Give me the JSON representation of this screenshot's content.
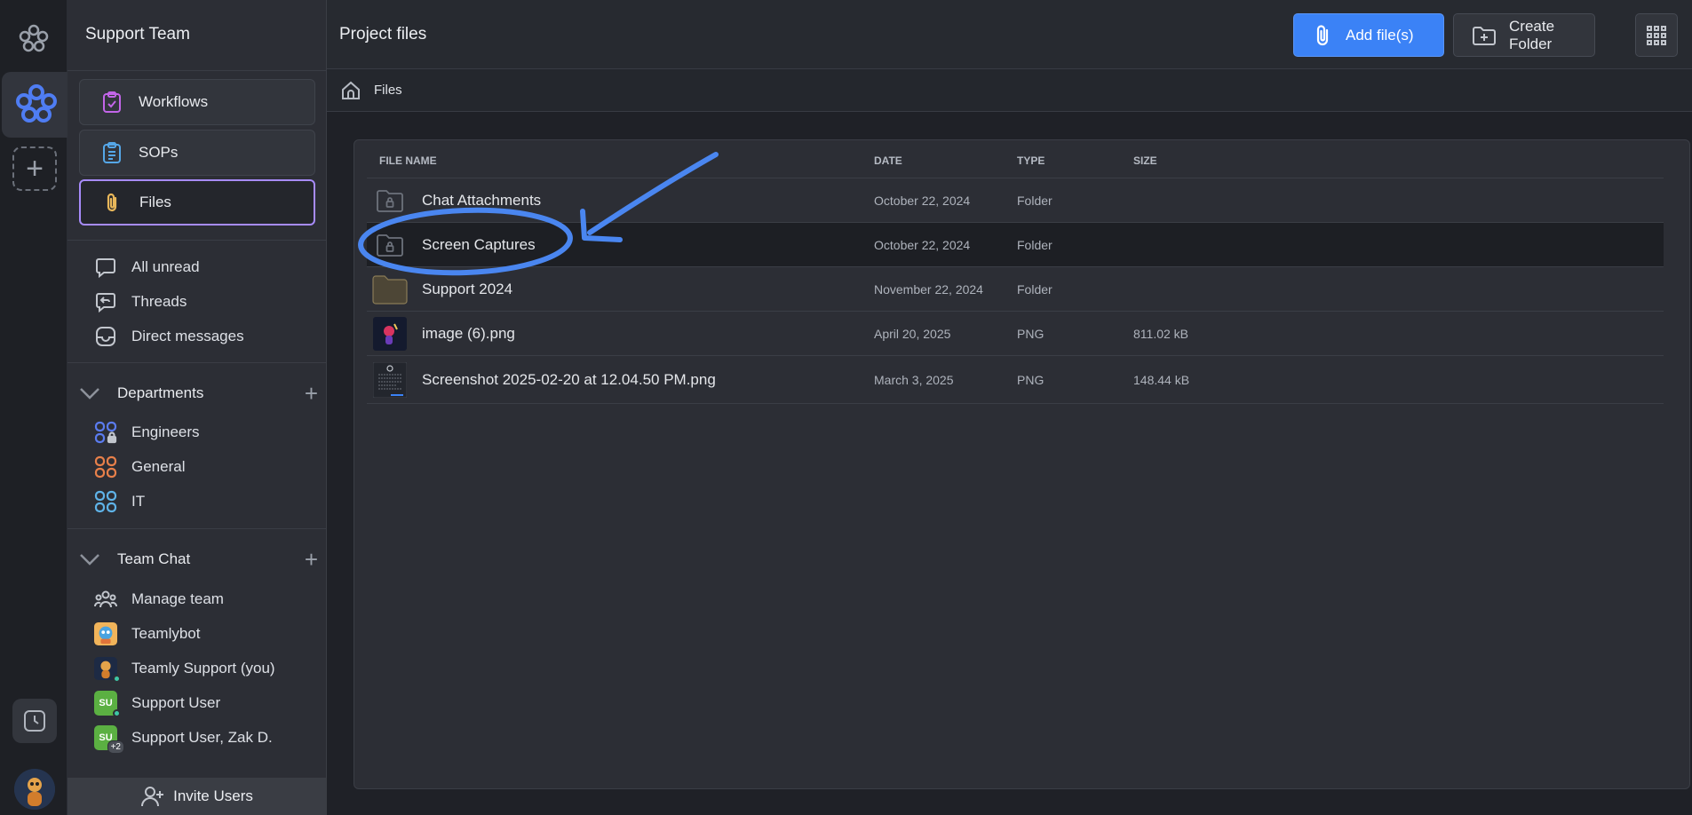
{
  "sidebar": {
    "workspace_title": "Support Team",
    "nav": [
      {
        "label": "Workflows",
        "icon": "clipboard-check-icon"
      },
      {
        "label": "SOPs",
        "icon": "clipboard-list-icon"
      },
      {
        "label": "Files",
        "icon": "paperclip-icon",
        "active": true
      }
    ],
    "quick": [
      {
        "label": "All unread",
        "icon": "chat-bubble-icon"
      },
      {
        "label": "Threads",
        "icon": "thread-icon"
      },
      {
        "label": "Direct messages",
        "icon": "inbox-icon"
      }
    ],
    "departments": {
      "label": "Departments",
      "items": [
        {
          "label": "Engineers",
          "color": "#5b7cf0"
        },
        {
          "label": "General",
          "color": "#e8804a"
        },
        {
          "label": "IT",
          "color": "#5fb3e8"
        }
      ]
    },
    "team_chat": {
      "label": "Team Chat",
      "items": [
        {
          "label": "Manage team",
          "icon": "team-icon"
        },
        {
          "label": "Teamlybot",
          "icon": "bot-avatar"
        },
        {
          "label": "Teamly Support (you)",
          "icon": "user-avatar"
        },
        {
          "label": "Support User",
          "avatar_text": "SU",
          "avatar_color": "#5bb042"
        },
        {
          "label": "Support User, Zak D.",
          "avatar_text": "SU",
          "avatar_color": "#5bb042",
          "badge": "+2"
        }
      ]
    },
    "invite_label": "Invite Users"
  },
  "header": {
    "title": "Project files",
    "add_files_label": "Add file(s)",
    "create_folder_label": "Create Folder"
  },
  "breadcrumb": {
    "current": "Files"
  },
  "table": {
    "columns": [
      "FILE NAME",
      "DATE",
      "TYPE",
      "SIZE"
    ],
    "rows": [
      {
        "name": "Chat Attachments",
        "date": "October 22, 2024",
        "type": "Folder",
        "size": "",
        "thumb": "locked-folder"
      },
      {
        "name": "Screen Captures",
        "date": "October 22, 2024",
        "type": "Folder",
        "size": "",
        "thumb": "locked-folder",
        "highlighted": true
      },
      {
        "name": "Support 2024",
        "date": "November 22, 2024",
        "type": "Folder",
        "size": "",
        "thumb": "folder"
      },
      {
        "name": "image (6).png",
        "date": "April 20, 2025",
        "type": "PNG",
        "size": "811.02 kB",
        "thumb": "image"
      },
      {
        "name": "Screenshot 2025-02-20 at 12.04.50 PM.png",
        "date": "March 3, 2025",
        "type": "PNG",
        "size": "148.44 kB",
        "thumb": "screenshot"
      }
    ]
  },
  "colors": {
    "accent": "#3b82f6",
    "active_border": "#a78bfa",
    "annotation": "#4a86f0"
  }
}
